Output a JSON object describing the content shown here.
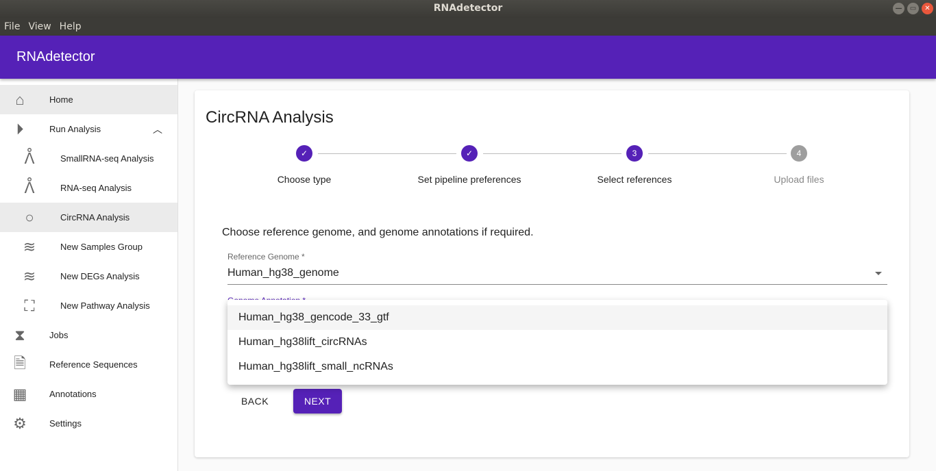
{
  "window": {
    "title": "RNAdetector",
    "minimize": "—",
    "maximize": "▭",
    "close": "✕"
  },
  "menubar": [
    "File",
    "View",
    "Help"
  ],
  "appbar": {
    "title": "RNAdetector"
  },
  "sidebar": [
    {
      "label": "Home",
      "icon": "home-icon"
    },
    {
      "label": "Run Analysis",
      "icon": "play-circle-icon"
    },
    {
      "label": "SmallRNA-seq Analysis",
      "icon": "dna-icon"
    },
    {
      "label": "RNA-seq Analysis",
      "icon": "dna-icon"
    },
    {
      "label": "CircRNA Analysis",
      "icon": "circle-icon"
    },
    {
      "label": "New Samples Group",
      "icon": "layers-icon"
    },
    {
      "label": "New DEGs Analysis",
      "icon": "layers-icon"
    },
    {
      "label": "New Pathway Analysis",
      "icon": "pathway-icon"
    },
    {
      "label": "Jobs",
      "icon": "hourglass-icon"
    },
    {
      "label": "Reference Sequences",
      "icon": "file-icon"
    },
    {
      "label": "Annotations",
      "icon": "table-icon"
    },
    {
      "label": "Settings",
      "icon": "gear-icon"
    }
  ],
  "main": {
    "title": "CircRNA Analysis",
    "steps": [
      {
        "num": "✓",
        "label": "Choose type"
      },
      {
        "num": "✓",
        "label": "Set pipeline preferences"
      },
      {
        "num": "3",
        "label": "Select references"
      },
      {
        "num": "4",
        "label": "Upload files"
      }
    ],
    "instructions": "Choose reference genome, and genome annotations if required.",
    "ref_label": "Reference Genome *",
    "ref_value": "Human_hg38_genome",
    "ann_label": "Genome Annotation *",
    "options": [
      "Human_hg38_gencode_33_gtf",
      "Human_hg38lift_circRNAs",
      "Human_hg38lift_small_ncRNAs"
    ],
    "back": "BACK",
    "next": "NEXT"
  },
  "colors": {
    "primary": "#5521b7"
  }
}
